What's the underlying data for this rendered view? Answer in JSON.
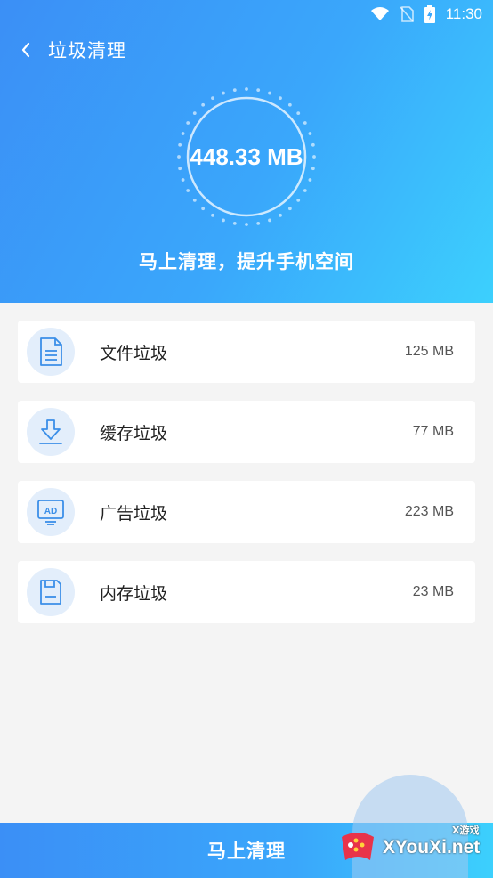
{
  "status_bar": {
    "time": "11:30"
  },
  "header": {
    "title": "垃圾清理"
  },
  "gauge": {
    "total_size": "448.33 MB"
  },
  "hero": {
    "subtitle": "马上清理，提升手机空间"
  },
  "items": [
    {
      "label": "文件垃圾",
      "size": "125 MB",
      "icon": "document-icon"
    },
    {
      "label": "缓存垃圾",
      "size": "77 MB",
      "icon": "download-icon"
    },
    {
      "label": "广告垃圾",
      "size": "223 MB",
      "icon": "ad-monitor-icon"
    },
    {
      "label": "内存垃圾",
      "size": "23 MB",
      "icon": "memory-card-icon"
    }
  ],
  "footer": {
    "clean_button_label": "马上清理"
  },
  "watermark": {
    "text": "XYouXi.net",
    "small_text": "X游戏"
  },
  "colors": {
    "accent": "#3a9cf8",
    "icon_stroke": "#3b8fe8",
    "icon_bg": "#e3eefb"
  }
}
